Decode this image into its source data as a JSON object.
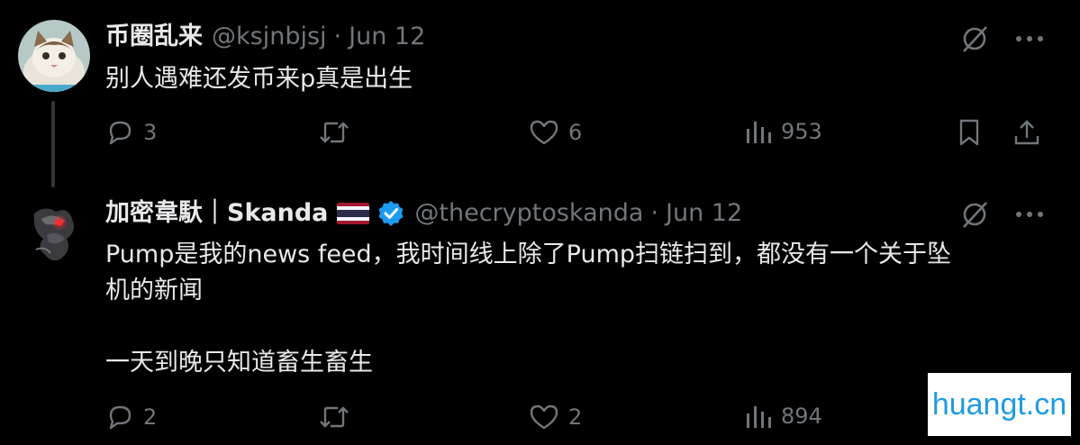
{
  "tweets": [
    {
      "name": "币圈乱来",
      "handle": "@ksjnbjsj",
      "separator": "·",
      "date": "Jun 12",
      "text": "别人遇难还发币来p真是出生",
      "replies": "3",
      "likes": "6",
      "views": "953",
      "avatar_icon": "cat-avatar"
    },
    {
      "name": "加密韋馱｜Skanda",
      "handle": "@thecryptoskanda",
      "separator": "·",
      "date": "Jun 12",
      "text": "Pump是我的news feed，我时间线上除了Pump扫链扫到，都没有一个关于坠\n机的新闻\n\n一天到晚只知道畜生畜生",
      "replies": "2",
      "likes": "2",
      "views": "894",
      "avatar_icon": "dragon-avatar",
      "flag_icon": "thailand-flag-icon",
      "verified_icon": "verified-badge-icon"
    }
  ],
  "watermark": "huangt.cn",
  "colors": {
    "background": "#000000",
    "text": "#e7e9ea",
    "muted": "#71767b",
    "verified": "#1d9bf0",
    "watermark": "#1e9be0"
  }
}
